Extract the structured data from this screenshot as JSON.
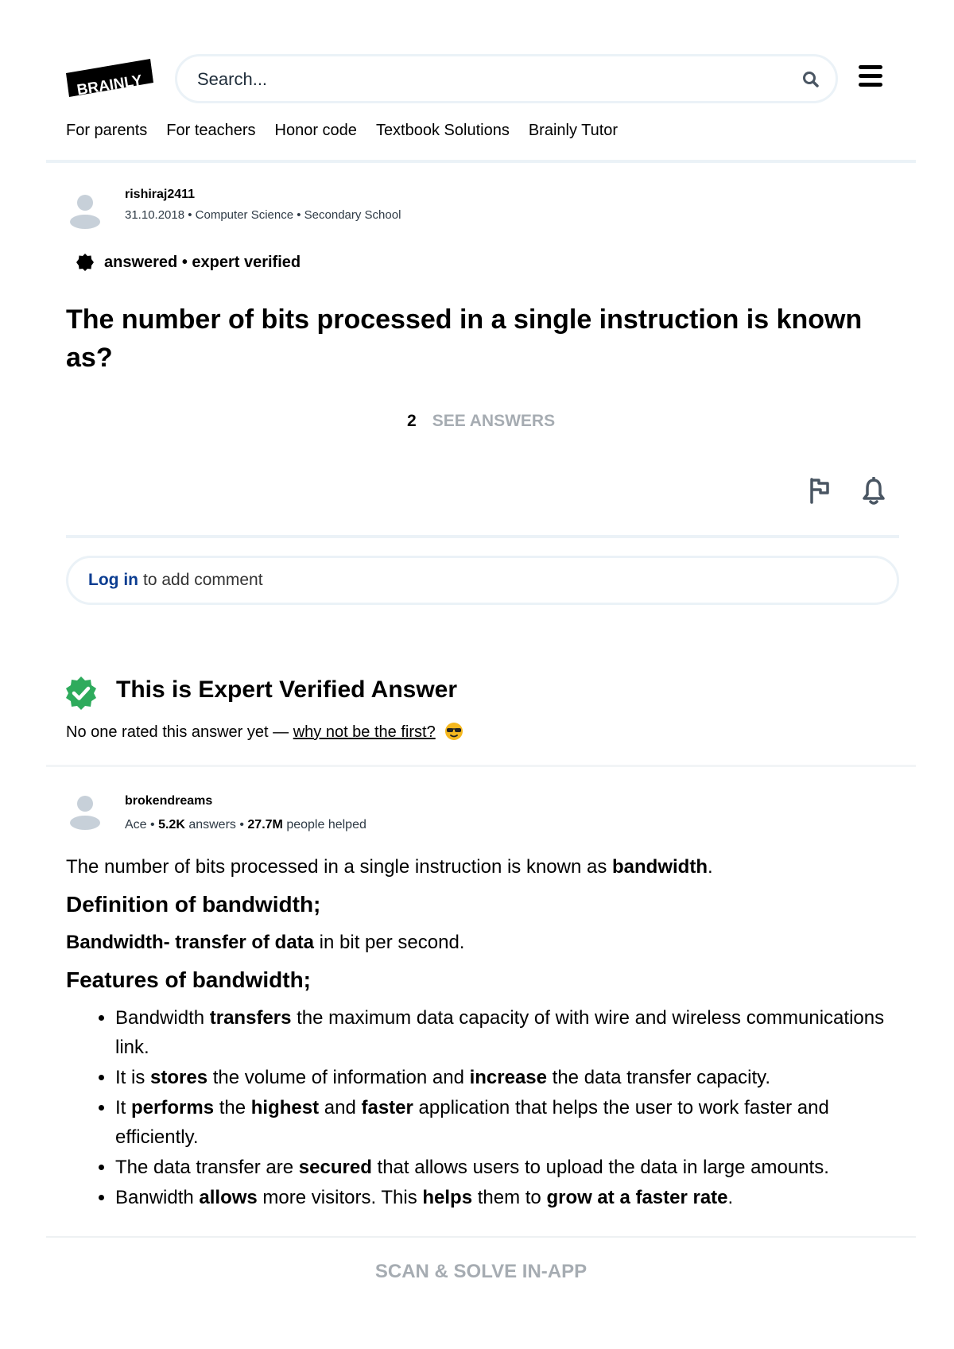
{
  "header": {
    "logo_text": "BRAINLY",
    "search_placeholder": "Search...",
    "nav": [
      "For parents",
      "For teachers",
      "Honor code",
      "Textbook Solutions",
      "Brainly Tutor"
    ]
  },
  "question": {
    "author": "rishiraj2411",
    "date": "31.10.2018",
    "subject": "Computer Science",
    "level": "Secondary School",
    "status": "answered • expert verified",
    "title": "The number of bits processed in a single instruction is known as?",
    "answer_count": "2",
    "see_answers_label": "SEE ANSWERS",
    "comment_login": "Log in",
    "comment_rest": "to add comment"
  },
  "answer": {
    "verified_title": "This is Expert Verified Answer",
    "rating_text": "No one rated this answer yet —",
    "rating_link": "why not be the first?",
    "author": "brokendreams",
    "rank": "Ace",
    "answers_count": "5.2K",
    "answers_label": "answers",
    "helped_count": "27.7M",
    "helped_label": "people helped",
    "intro_pre": "The number of bits processed in a single instruction is known as ",
    "intro_bold": "bandwidth",
    "intro_post": ".",
    "heading1": "Definition of bandwidth;",
    "def_bold": "Bandwidth- transfer of data",
    "def_rest": " in bit per second.",
    "heading2": "Features of bandwidth;",
    "bullets": [
      {
        "a": "Bandwidth ",
        "b": "transfers",
        "c": " the maximum data capacity of with wire and wireless communications link."
      },
      {
        "a": "It is ",
        "b": "stores",
        "c": " the volume of information and ",
        "d": "increase",
        "e": " the data transfer capacity."
      },
      {
        "a": "It ",
        "b": "performs",
        "c": " the ",
        "d": "highest",
        "e": " and ",
        "f": "faster",
        "g": " application that helps the user to work faster and efficiently."
      },
      {
        "a": "The data transfer are ",
        "b": "secured",
        "c": " that allows users to upload the data in  large amounts."
      },
      {
        "a": "Banwidth ",
        "b": "allows",
        "c": " more visitors. This ",
        "d": "helps",
        "e": " them to ",
        "f": "grow at a faster rate",
        "g": "."
      }
    ]
  },
  "bottom": {
    "scan_label": "SCAN & SOLVE IN-APP"
  },
  "colors": {
    "border": "#ebf2f7",
    "link": "#0b3d91",
    "muted": "#a6acb2",
    "verified": "#2eab5c"
  }
}
